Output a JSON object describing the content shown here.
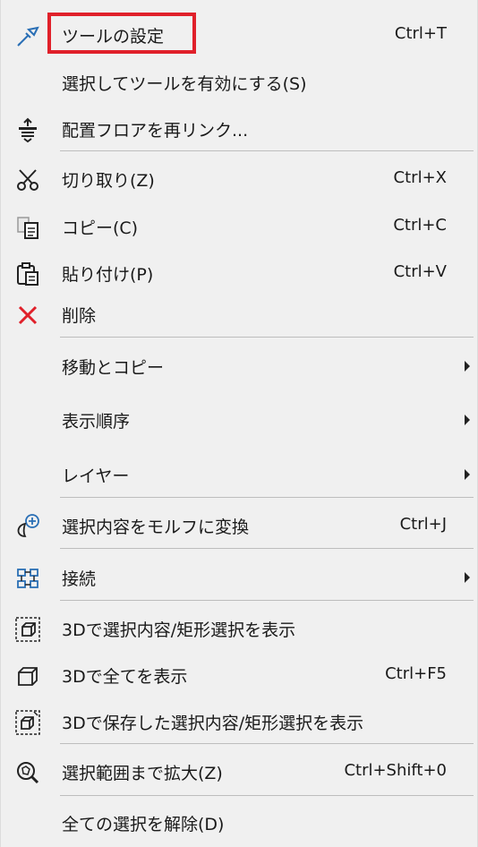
{
  "menu": {
    "items": [
      {
        "label": "ツールの設定",
        "shortcut": "Ctrl+T",
        "icon": "pipette-tool-icon"
      },
      {
        "label": "選択してツールを有効にする(S)",
        "shortcut": "",
        "icon": ""
      },
      {
        "label": "配置フロアを再リンク...",
        "shortcut": "",
        "icon": "floor-relink-icon"
      },
      {
        "label": "切り取り(Z)",
        "shortcut": "Ctrl+X",
        "icon": "scissors-icon"
      },
      {
        "label": "コピー(C)",
        "shortcut": "Ctrl+C",
        "icon": "copy-icon"
      },
      {
        "label": "貼り付け(P)",
        "shortcut": "Ctrl+V",
        "icon": "paste-icon"
      },
      {
        "label": "削除",
        "shortcut": "",
        "icon": "delete-x-icon"
      },
      {
        "label": "移動とコピー",
        "shortcut": "",
        "icon": "",
        "submenu": true
      },
      {
        "label": "表示順序",
        "shortcut": "",
        "icon": "",
        "submenu": true
      },
      {
        "label": "レイヤー",
        "shortcut": "",
        "icon": "",
        "submenu": true
      },
      {
        "label": "選択内容をモルフに変換",
        "shortcut": "Ctrl+J",
        "icon": "morph-convert-icon"
      },
      {
        "label": "接続",
        "shortcut": "",
        "icon": "connect-icon",
        "submenu": true
      },
      {
        "label": "3Dで選択内容/矩形選択を表示",
        "shortcut": "",
        "icon": "3d-selection-icon"
      },
      {
        "label": "3Dで全てを表示",
        "shortcut": "Ctrl+F5",
        "icon": "3d-all-icon"
      },
      {
        "label": "3Dで保存した選択内容/矩形選択を表示",
        "shortcut": "",
        "icon": "3d-saved-selection-icon"
      },
      {
        "label": "選択範囲まで拡大(Z)",
        "shortcut": "Ctrl+Shift+0",
        "icon": "zoom-to-selection-icon"
      },
      {
        "label": "全ての選択を解除(D)",
        "shortcut": "",
        "icon": ""
      }
    ]
  },
  "colors": {
    "highlight_border": "#e0202a",
    "delete_icon": "#e0202a",
    "icon_blue": "#2a6fb5"
  }
}
